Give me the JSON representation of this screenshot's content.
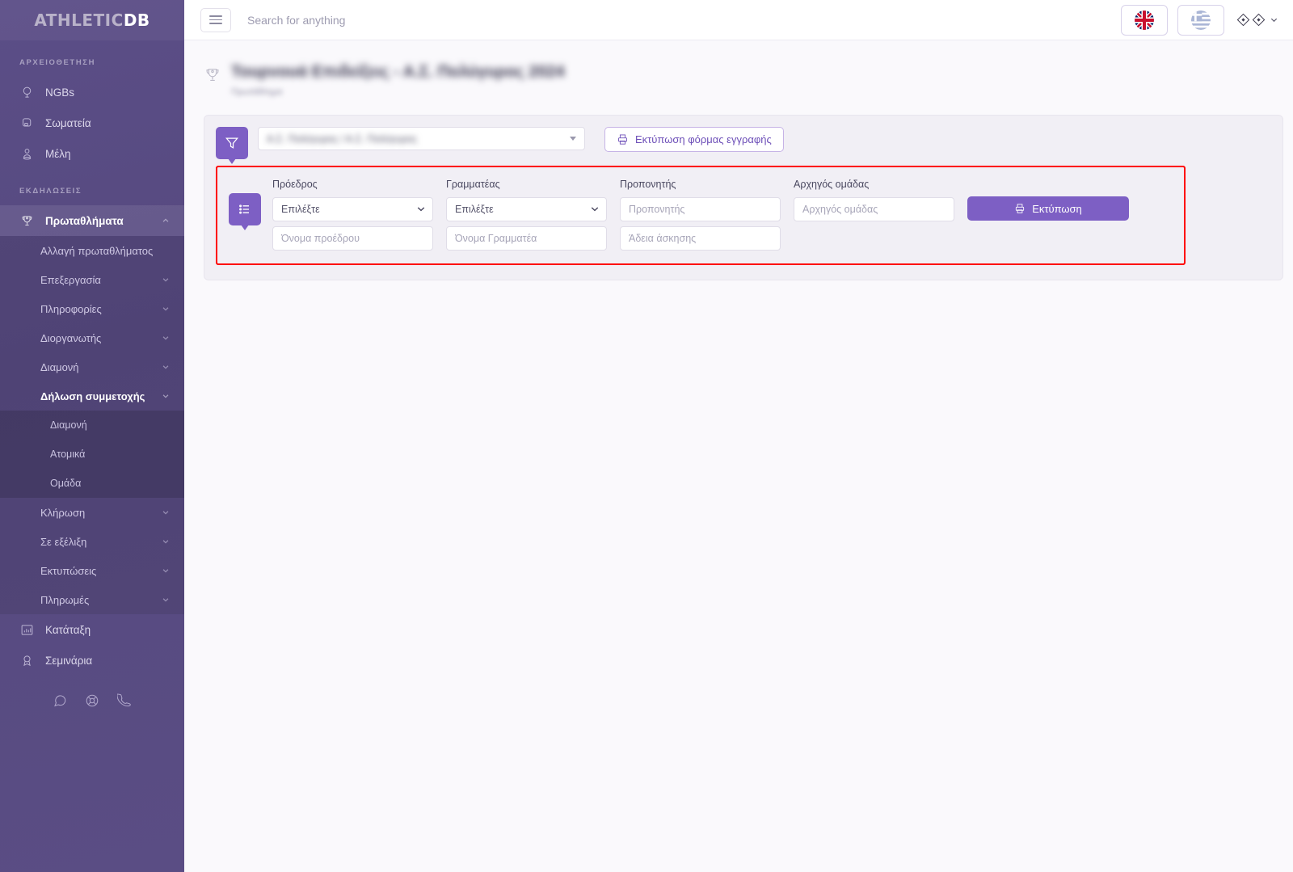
{
  "brand": {
    "part1": "ATHLETIC",
    "part2": "DB"
  },
  "sidebar": {
    "sections": [
      {
        "title": "ΑΡΧΕΙΟΘΕΤΗΣΗ"
      },
      {
        "title": "ΕΚΔΗΛΩΣΕΙΣ"
      }
    ],
    "archive_items": [
      {
        "label": "NGBs",
        "icon": "whistle-icon"
      },
      {
        "label": "Σωματεία",
        "icon": "club-icon"
      },
      {
        "label": "Μέλη",
        "icon": "member-icon"
      }
    ],
    "events_parent": {
      "label": "Πρωταθλήματα",
      "icon": "trophy-icon"
    },
    "events_sub": [
      {
        "label": "Αλλαγή πρωταθλήματος",
        "has_chevron": false,
        "bold": false
      },
      {
        "label": "Επεξεργασία",
        "has_chevron": true,
        "bold": false
      },
      {
        "label": "Πληροφορίες",
        "has_chevron": true,
        "bold": false
      },
      {
        "label": "Διοργανωτής",
        "has_chevron": true,
        "bold": false
      },
      {
        "label": "Διαμονή",
        "has_chevron": true,
        "bold": false
      },
      {
        "label": "Δήλωση συμμετοχής",
        "has_chevron": true,
        "bold": true
      }
    ],
    "declaration_sub": [
      {
        "label": "Διαμονή"
      },
      {
        "label": "Ατομικά"
      },
      {
        "label": "Ομάδα"
      }
    ],
    "events_sub_after": [
      {
        "label": "Κλήρωση",
        "has_chevron": true
      },
      {
        "label": "Σε εξέλιξη",
        "has_chevron": true
      },
      {
        "label": "Εκτυπώσεις",
        "has_chevron": true
      },
      {
        "label": "Πληρωμές",
        "has_chevron": true
      }
    ],
    "bottom_items": [
      {
        "label": "Κατάταξη",
        "icon": "chart-icon"
      },
      {
        "label": "Σεμινάρια",
        "icon": "award-icon"
      }
    ],
    "social_icons": [
      "chat-icon",
      "lifebuoy-icon",
      "phone-icon"
    ]
  },
  "topbar": {
    "search_placeholder": "Search for anything",
    "lang_en": "en-flag-icon",
    "lang_gr": "gr-flag-icon",
    "user_label": "◆◆"
  },
  "page": {
    "title": "Τουρνουά Επιδείξεις - Α.Σ. Πολύγυρος 2024",
    "subtitle": "Πρωτάθλημα"
  },
  "filter": {
    "team_value": "Α.Σ. Πολύγυρος / Α.Σ. Πολύγυρος",
    "print_form_label": "Εκτύπωση φόρμας εγγραφής"
  },
  "form": {
    "fields": [
      {
        "label": "Πρόεδρος",
        "select_value": "Επιλέξτε",
        "input_placeholder": "Όνομα προέδρου",
        "type": "select"
      },
      {
        "label": "Γραμματέας",
        "select_value": "Επιλέξτε",
        "input_placeholder": "Όνομα Γραμματέα",
        "type": "select"
      },
      {
        "label": "Προπονητής",
        "input_placeholder": "Προπονητής",
        "input2_placeholder": "Άδεια άσκησης",
        "type": "text"
      },
      {
        "label": "Αρχηγός ομάδας",
        "input_placeholder": "Αρχηγός ομάδας",
        "type": "text-single"
      }
    ],
    "print_button": "Εκτύπωση"
  },
  "colors": {
    "sidebar": "#584b81",
    "accent_purple": "#7d5fc4",
    "highlight_red": "#fe0000",
    "card_bg": "#f1eff5",
    "page_bg": "#faf9fc"
  }
}
